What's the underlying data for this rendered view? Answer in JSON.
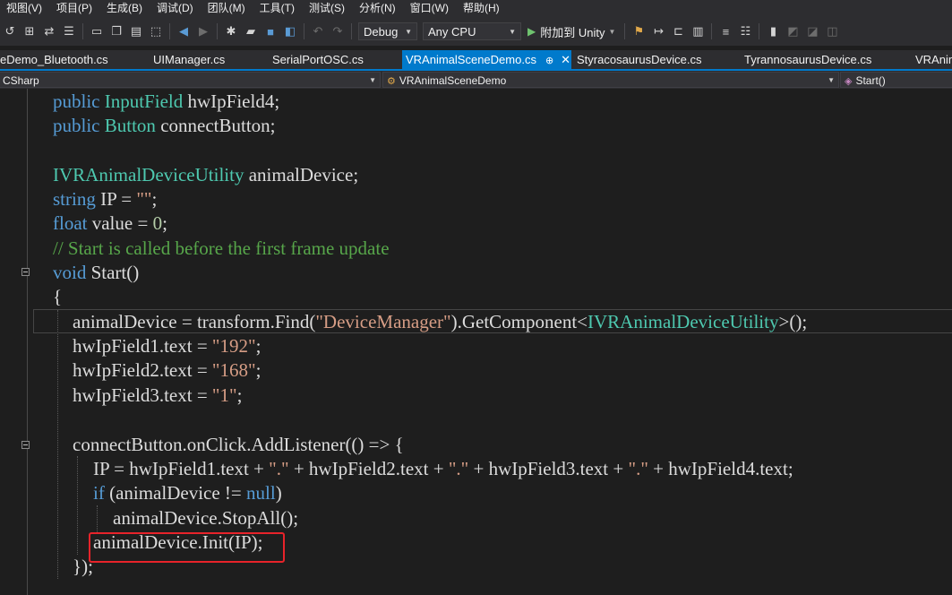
{
  "menu": [
    "视图(V)",
    "项目(P)",
    "生成(B)",
    "调试(D)",
    "团队(M)",
    "工具(T)",
    "测试(S)",
    "分析(N)",
    "窗口(W)",
    "帮助(H)"
  ],
  "toolbar": {
    "config": "Debug",
    "platform": "Any CPU",
    "attach_label": "附加到 Unity"
  },
  "tabs": [
    {
      "label": "eDemo_Bluetooth.cs"
    },
    {
      "label": "UIManager.cs"
    },
    {
      "label": "SerialPortOSC.cs"
    },
    {
      "label": "VRAnimalSceneDemo.cs",
      "pin": "⊕",
      "close": "✕",
      "active": true
    },
    {
      "label": "StyracosaurusDevice.cs"
    },
    {
      "label": "TyrannosaurusDevice.cs"
    },
    {
      "label": "VRAnim"
    }
  ],
  "navbar": {
    "project": "CSharp",
    "class": "VRAnimalSceneDemo",
    "member": "Start()"
  },
  "code": {
    "l1": {
      "kw": "public",
      "ty": "InputField",
      "rest": " hwIpField4;"
    },
    "l2": {
      "kw": "public",
      "ty": "Button",
      "rest": " connectButton;"
    },
    "l4": {
      "ty": "IVRAnimalDeviceUtility",
      "rest": " animalDevice;"
    },
    "l5": {
      "kw": "string",
      "rest": " IP = ",
      "str": "\"\"",
      "end": ";"
    },
    "l6": {
      "kw": "float",
      "rest": " value = ",
      "num": "0",
      "end": ";"
    },
    "l7": {
      "cm": "// Start is called before the first frame update"
    },
    "l8": {
      "kw": "void",
      "rest": " Start()"
    },
    "l9": {
      "text": "{"
    },
    "l10": {
      "a": "animalDevice = transform.Find(",
      "str": "\"DeviceManager\"",
      "b": ").GetComponent<",
      "ty": "IVRAnimalDeviceUtility",
      "c": ">();"
    },
    "l11": {
      "a": "hwIpField1.text = ",
      "str": "\"192\"",
      "end": ";"
    },
    "l12": {
      "a": "hwIpField2.text = ",
      "str": "\"168\"",
      "end": ";"
    },
    "l13": {
      "a": "hwIpField3.text = ",
      "str": "\"1\"",
      "end": ";"
    },
    "l15": {
      "text": "connectButton.onClick.AddListener(() => {"
    },
    "l16": {
      "a": "IP = hwIpField1.text + ",
      "s1": "\".\"",
      "b": " + hwIpField2.text + ",
      "s2": "\".\"",
      "c": " + hwIpField3.text + ",
      "s3": "\".\"",
      "d": " + hwIpField4.text;"
    },
    "l17": {
      "kw": "if",
      "a": " (animalDevice != ",
      "kw2": "null",
      "b": ")"
    },
    "l18": {
      "text": "animalDevice.StopAll();"
    },
    "l19": {
      "text": "animalDevice.Init(IP);"
    },
    "l20": {
      "text": "});"
    }
  }
}
